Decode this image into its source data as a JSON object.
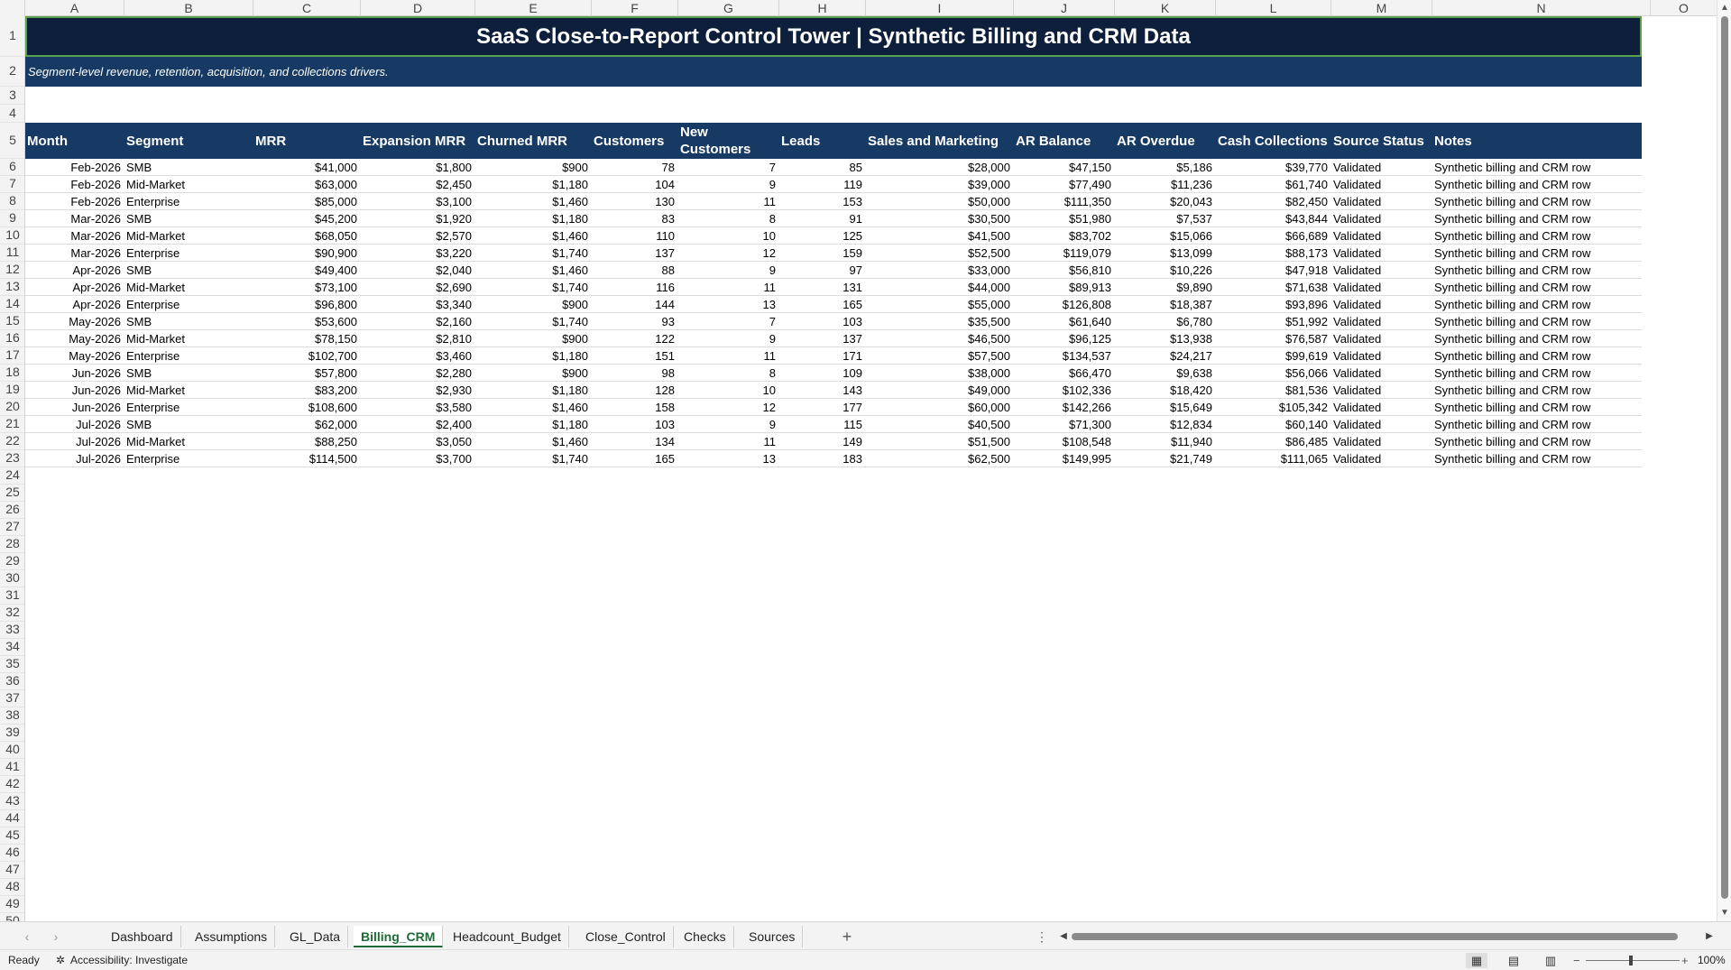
{
  "columns": [
    "A",
    "B",
    "C",
    "D",
    "E",
    "F",
    "G",
    "H",
    "I",
    "J",
    "K",
    "L",
    "M",
    "N",
    "O"
  ],
  "rows": [
    "1",
    "2",
    "3",
    "4",
    "5",
    "6",
    "7",
    "8",
    "9",
    "10",
    "11",
    "12",
    "13",
    "14",
    "15",
    "16",
    "17",
    "18",
    "19",
    "20",
    "21",
    "22",
    "23",
    "24",
    "25",
    "26",
    "27",
    "28",
    "29",
    "30",
    "31",
    "32",
    "33",
    "34",
    "35",
    "36",
    "37",
    "38",
    "39",
    "40",
    "41",
    "42",
    "43",
    "44",
    "45",
    "46",
    "47",
    "48",
    "49",
    "50"
  ],
  "sheet": {
    "title": "SaaS Close-to-Report Control Tower | Synthetic Billing and CRM Data",
    "subtitle": "Segment-level revenue, retention, acquisition, and collections drivers.",
    "headers": [
      "Month",
      "Segment",
      "MRR",
      "Expansion MRR",
      "Churned MRR",
      "Customers",
      "New Customers",
      "Leads",
      "Sales and Marketing",
      "AR Balance",
      "AR Overdue",
      "Cash Collections",
      "Source Status",
      "Notes"
    ],
    "data": [
      [
        "Feb-2026",
        "SMB",
        "$41,000",
        "$1,800",
        "$900",
        "78",
        "7",
        "85",
        "$28,000",
        "$47,150",
        "$5,186",
        "$39,770",
        "Validated",
        "Synthetic billing and CRM row"
      ],
      [
        "Feb-2026",
        "Mid-Market",
        "$63,000",
        "$2,450",
        "$1,180",
        "104",
        "9",
        "119",
        "$39,000",
        "$77,490",
        "$11,236",
        "$61,740",
        "Validated",
        "Synthetic billing and CRM row"
      ],
      [
        "Feb-2026",
        "Enterprise",
        "$85,000",
        "$3,100",
        "$1,460",
        "130",
        "11",
        "153",
        "$50,000",
        "$111,350",
        "$20,043",
        "$82,450",
        "Validated",
        "Synthetic billing and CRM row"
      ],
      [
        "Mar-2026",
        "SMB",
        "$45,200",
        "$1,920",
        "$1,180",
        "83",
        "8",
        "91",
        "$30,500",
        "$51,980",
        "$7,537",
        "$43,844",
        "Validated",
        "Synthetic billing and CRM row"
      ],
      [
        "Mar-2026",
        "Mid-Market",
        "$68,050",
        "$2,570",
        "$1,460",
        "110",
        "10",
        "125",
        "$41,500",
        "$83,702",
        "$15,066",
        "$66,689",
        "Validated",
        "Synthetic billing and CRM row"
      ],
      [
        "Mar-2026",
        "Enterprise",
        "$90,900",
        "$3,220",
        "$1,740",
        "137",
        "12",
        "159",
        "$52,500",
        "$119,079",
        "$13,099",
        "$88,173",
        "Validated",
        "Synthetic billing and CRM row"
      ],
      [
        "Apr-2026",
        "SMB",
        "$49,400",
        "$2,040",
        "$1,460",
        "88",
        "9",
        "97",
        "$33,000",
        "$56,810",
        "$10,226",
        "$47,918",
        "Validated",
        "Synthetic billing and CRM row"
      ],
      [
        "Apr-2026",
        "Mid-Market",
        "$73,100",
        "$2,690",
        "$1,740",
        "116",
        "11",
        "131",
        "$44,000",
        "$89,913",
        "$9,890",
        "$71,638",
        "Validated",
        "Synthetic billing and CRM row"
      ],
      [
        "Apr-2026",
        "Enterprise",
        "$96,800",
        "$3,340",
        "$900",
        "144",
        "13",
        "165",
        "$55,000",
        "$126,808",
        "$18,387",
        "$93,896",
        "Validated",
        "Synthetic billing and CRM row"
      ],
      [
        "May-2026",
        "SMB",
        "$53,600",
        "$2,160",
        "$1,740",
        "93",
        "7",
        "103",
        "$35,500",
        "$61,640",
        "$6,780",
        "$51,992",
        "Validated",
        "Synthetic billing and CRM row"
      ],
      [
        "May-2026",
        "Mid-Market",
        "$78,150",
        "$2,810",
        "$900",
        "122",
        "9",
        "137",
        "$46,500",
        "$96,125",
        "$13,938",
        "$76,587",
        "Validated",
        "Synthetic billing and CRM row"
      ],
      [
        "May-2026",
        "Enterprise",
        "$102,700",
        "$3,460",
        "$1,180",
        "151",
        "11",
        "171",
        "$57,500",
        "$134,537",
        "$24,217",
        "$99,619",
        "Validated",
        "Synthetic billing and CRM row"
      ],
      [
        "Jun-2026",
        "SMB",
        "$57,800",
        "$2,280",
        "$900",
        "98",
        "8",
        "109",
        "$38,000",
        "$66,470",
        "$9,638",
        "$56,066",
        "Validated",
        "Synthetic billing and CRM row"
      ],
      [
        "Jun-2026",
        "Mid-Market",
        "$83,200",
        "$2,930",
        "$1,180",
        "128",
        "10",
        "143",
        "$49,000",
        "$102,336",
        "$18,420",
        "$81,536",
        "Validated",
        "Synthetic billing and CRM row"
      ],
      [
        "Jun-2026",
        "Enterprise",
        "$108,600",
        "$3,580",
        "$1,460",
        "158",
        "12",
        "177",
        "$60,000",
        "$142,266",
        "$15,649",
        "$105,342",
        "Validated",
        "Synthetic billing and CRM row"
      ],
      [
        "Jul-2026",
        "SMB",
        "$62,000",
        "$2,400",
        "$1,180",
        "103",
        "9",
        "115",
        "$40,500",
        "$71,300",
        "$12,834",
        "$60,140",
        "Validated",
        "Synthetic billing and CRM row"
      ],
      [
        "Jul-2026",
        "Mid-Market",
        "$88,250",
        "$3,050",
        "$1,460",
        "134",
        "11",
        "149",
        "$51,500",
        "$108,548",
        "$11,940",
        "$86,485",
        "Validated",
        "Synthetic billing and CRM row"
      ],
      [
        "Jul-2026",
        "Enterprise",
        "$114,500",
        "$3,700",
        "$1,740",
        "165",
        "13",
        "183",
        "$62,500",
        "$149,995",
        "$21,749",
        "$111,065",
        "Validated",
        "Synthetic billing and CRM row"
      ]
    ]
  },
  "tabs": {
    "items": [
      "Dashboard",
      "Assumptions",
      "GL_Data",
      "Billing_CRM",
      "Headcount_Budget",
      "Close_Control",
      "Checks",
      "Sources"
    ],
    "active": "Billing_CRM",
    "add_label": "+",
    "more_label": "⋮"
  },
  "status": {
    "ready": "Ready",
    "accessibility": "Accessibility: Investigate",
    "zoom": "100%"
  },
  "colors": {
    "title_bg": "#0d1f3a",
    "header_bg": "#163a63",
    "active_tab": "#1e6b37"
  }
}
